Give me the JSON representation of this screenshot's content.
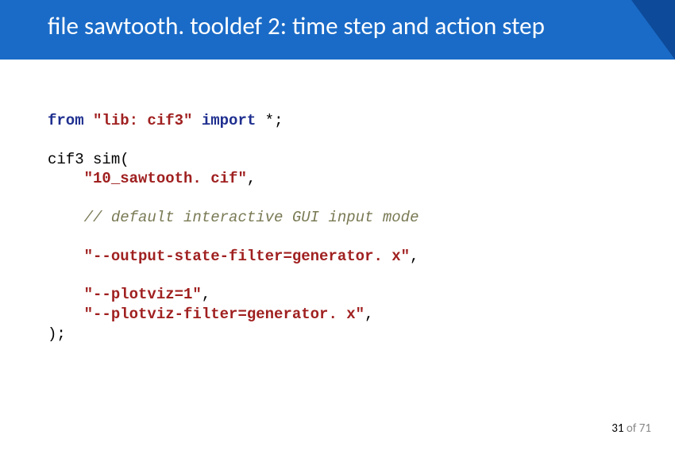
{
  "title": "file sawtooth. tooldef 2: time step and action step",
  "code": {
    "l1_from": "from",
    "l1_lib": "\"lib: cif3\"",
    "l1_import": "import",
    "l1_rest": " *;",
    "l2": "cif3 sim(",
    "l3": "    \"10_sawtooth. cif\"",
    "l3_tail": ",",
    "l4": "    // default interactive GUI input mode",
    "l5": "    \"--output-state-filter=generator. x\"",
    "l5_tail": ",",
    "l6": "    \"--plotviz=1\"",
    "l6_tail": ",",
    "l7": "    \"--plotviz-filter=generator. x\"",
    "l7_tail": ",",
    "l8": ");"
  },
  "page": {
    "current": "31",
    "of": "of",
    "total": "71"
  }
}
